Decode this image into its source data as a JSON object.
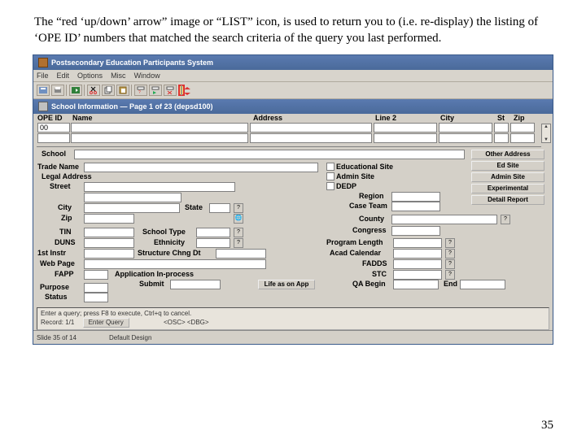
{
  "caption": "The “red ‘up/down’ arrow” image or “LIST” icon, is used to return you to (i.e. re-display) the listing of ‘OPE ID’ numbers that matched the search criteria of the query you last performed.",
  "page_number": "35",
  "titlebar": {
    "text": "Postsecondary Education Participants System"
  },
  "menubar": {
    "items": [
      "File",
      "Edit",
      "Options",
      "Misc",
      "Window"
    ]
  },
  "subtitle": {
    "text": "School Information — Page 1 of 23 (depsd100)"
  },
  "toolbar": {
    "list_label": "List"
  },
  "headers": {
    "ope_id": "OPE ID",
    "name": "Name",
    "address": "Address",
    "line2": "Line 2",
    "city": "City",
    "st": "St",
    "zip": "Zip"
  },
  "labels": {
    "school": "School",
    "trade_name": "Trade Name",
    "legal_address": "Legal Address",
    "street": "Street",
    "city": "City",
    "state": "State",
    "zip": "Zip",
    "tin": "TIN",
    "duns": "DUNS",
    "first_instr": "1st Instr",
    "web_page": "Web Page",
    "fapp": "FAPP",
    "purpose": "Purpose",
    "status": "Status",
    "school_type": "School Type",
    "ethnicity": "Ethnicity",
    "structure_chng_dt": "Structure Chng Dt",
    "application_inprocess": "Application In-process",
    "submit": "Submit",
    "educational_site": "Educational Site",
    "admin_site": "Admin Site",
    "dedp": "DEDP",
    "region": "Region",
    "case_team": "Case Team",
    "county": "County",
    "congress": "Congress",
    "program_length": "Program Length",
    "acad_calendar": "Acad Calendar",
    "fadds": "FADDS",
    "stc": "STC",
    "qa_begin": "QA Begin",
    "end": "End"
  },
  "buttons": {
    "other_address": "Other Address",
    "ed_site": "Ed Site",
    "admin_site_btn": "Admin Site",
    "experimental": "Experimental",
    "detail_report": "Detail Report",
    "life_as_on_app": "Life as on App"
  },
  "values": {
    "ope_id": "00"
  },
  "query": {
    "line1": "Enter a query; press F8 to execute, Ctrl+q to cancel.",
    "line2_label": "Record: 1/1",
    "btn1": "Enter Query",
    "tags": "<OSC> <DBG>"
  },
  "status": {
    "slide": "Slide 35 of 14",
    "design": "Default Design"
  }
}
